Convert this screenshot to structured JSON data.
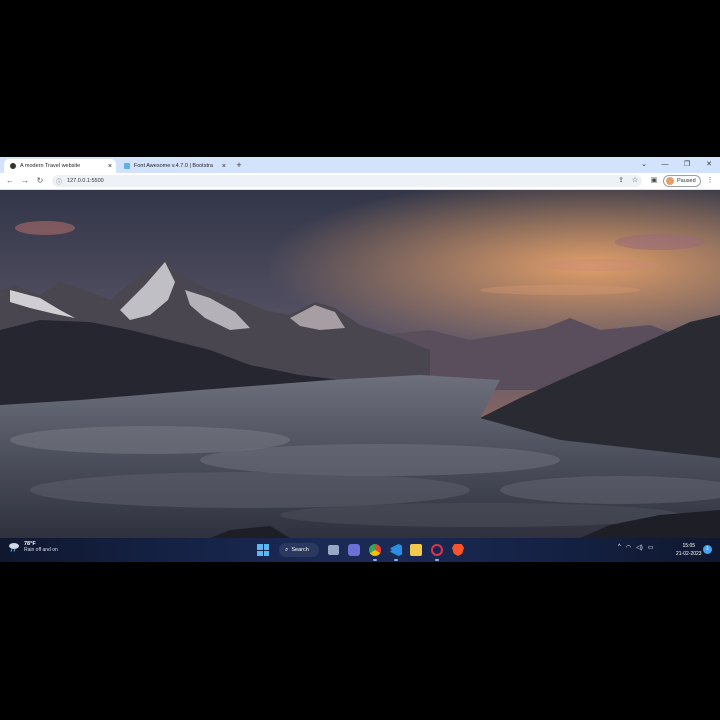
{
  "browser": {
    "tabs": [
      {
        "title": "A modern Travel website",
        "active": true
      },
      {
        "title": "Font Awesome v.4.7.0 | Bootstra",
        "active": false
      }
    ],
    "new_tab_symbol": "+",
    "url": "127.0.0.1:5500",
    "profile_label": "Paused",
    "window_controls": {
      "tab_search": "⌄",
      "minimize": "—",
      "restore": "❐",
      "close": "✕"
    },
    "nav_icons": {
      "back": "←",
      "forward": "→",
      "reload": "↻"
    },
    "toolbar_icons": {
      "share": "⇪",
      "bookmark": "☆",
      "sidepanel": "▣",
      "menu": "⋮"
    }
  },
  "page": {
    "scene": "mountain-sunset-above-clouds",
    "colors": {
      "sky_top": "#3a3f55",
      "sky_glow": "#e08a5a",
      "cloud": "#8a8d96",
      "rock": "#2a2c34"
    }
  },
  "taskbar": {
    "weather": {
      "temp": "78°F",
      "condition": "Rain off and on"
    },
    "search_label": "Search",
    "clock": {
      "time": "15:05",
      "date": "21-02-2023"
    },
    "notification_count": "1",
    "tray_icons": {
      "chevron": "^",
      "wifi": "◠",
      "volume": "◁)",
      "battery": "▭"
    },
    "apps": [
      "task-view",
      "teams-chat",
      "chrome",
      "vs-code",
      "file-explorer",
      "opera-gx",
      "brave"
    ]
  }
}
